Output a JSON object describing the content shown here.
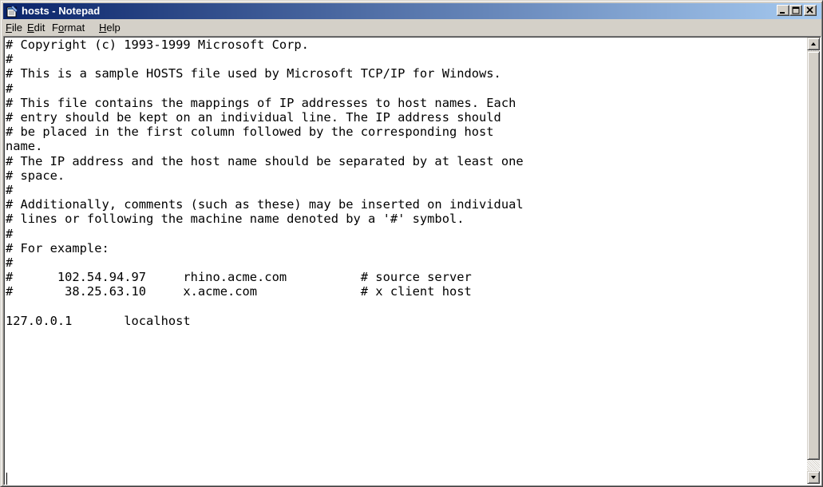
{
  "window": {
    "title": "hosts - Notepad"
  },
  "menu": {
    "file": {
      "mnemonic": "F",
      "rest": "ile"
    },
    "edit": {
      "mnemonic": "E",
      "rest": "dit"
    },
    "format": {
      "pre": "F",
      "mnemonic": "o",
      "rest": "rmat"
    },
    "help": {
      "mnemonic": "H",
      "rest": "elp"
    }
  },
  "editor": {
    "content": "# Copyright (c) 1993-1999 Microsoft Corp.\n#\n# This is a sample HOSTS file used by Microsoft TCP/IP for Windows.\n#\n# This file contains the mappings of IP addresses to host names. Each\n# entry should be kept on an individual line. The IP address should\n# be placed in the first column followed by the corresponding host\nname.\n# The IP address and the host name should be separated by at least one\n# space.\n#\n# Additionally, comments (such as these) may be inserted on individual\n# lines or following the machine name denoted by a '#' symbol.\n#\n# For example:\n#\n#      102.54.94.97     rhino.acme.com          # source server\n#       38.25.63.10     x.acme.com              # x client host\n\n127.0.0.1       localhost\n\n"
  },
  "colors": {
    "title_active_start": "#0a246a",
    "title_active_end": "#a6caf0",
    "face": "#d4d0c8",
    "editor_bg": "#ffffff"
  },
  "icons": {
    "app": "notepad-icon",
    "minimize": "minimize-icon",
    "maximize": "maximize-icon",
    "close": "close-icon",
    "scroll_up": "arrow-up-icon",
    "scroll_down": "arrow-down-icon"
  }
}
